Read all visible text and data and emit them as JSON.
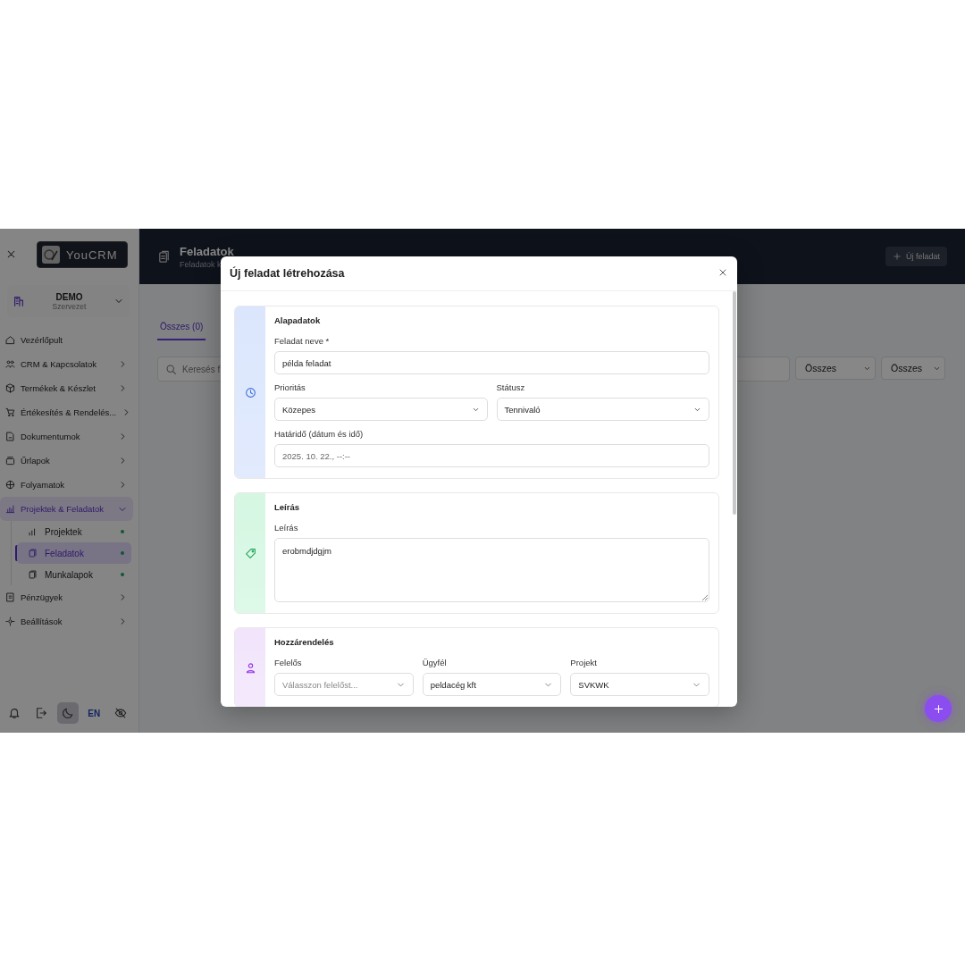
{
  "sidebar": {
    "logo": "YouCRM",
    "org": {
      "name": "DEMO",
      "subtitle": "Szervezet"
    },
    "items": [
      {
        "label": "Vezérlőpult",
        "kind": "link",
        "selected": false
      },
      {
        "label": "CRM & Kapcsolatok",
        "kind": "group",
        "expanded": false,
        "selected": false
      },
      {
        "label": "Termékek & Készlet",
        "kind": "group",
        "expanded": false,
        "selected": false
      },
      {
        "label": "Értékesítés & Rendelés...",
        "kind": "group",
        "expanded": false,
        "selected": false
      },
      {
        "label": "Dokumentumok",
        "kind": "group",
        "expanded": false,
        "selected": false
      },
      {
        "label": "Űrlapok",
        "kind": "group",
        "expanded": false,
        "selected": false
      },
      {
        "label": "Folyamatok",
        "kind": "group",
        "expanded": false,
        "selected": false
      },
      {
        "label": "Projektek & Feladatok",
        "kind": "group",
        "expanded": true,
        "selected": true,
        "children": [
          {
            "label": "Projektek",
            "selected": false
          },
          {
            "label": "Feladatok",
            "selected": true
          },
          {
            "label": "Munkalapok",
            "selected": false
          }
        ]
      },
      {
        "label": "Pénzügyek",
        "kind": "group",
        "expanded": false,
        "selected": false
      },
      {
        "label": "Beállítások",
        "kind": "group",
        "expanded": false,
        "selected": false
      }
    ],
    "footer": [
      {
        "kind": "bell",
        "selected": false
      },
      {
        "kind": "logout",
        "selected": false
      },
      {
        "kind": "moon",
        "selected": true
      },
      {
        "kind": "language",
        "label": "EN",
        "selected": false
      },
      {
        "kind": "eye-off",
        "selected": false
      }
    ]
  },
  "header": {
    "title": "Feladatok",
    "subtitle": "Feladatok k",
    "button": "Új feladat"
  },
  "tabs": [
    {
      "label": "Összes (0)",
      "selected": true
    }
  ],
  "filters": {
    "search": "Keresés f",
    "selects": [
      "Összes",
      "Összes"
    ]
  },
  "modal": {
    "title": "Új feladat létrehozása",
    "sections": [
      {
        "title": "Alapadatok",
        "color": "#dbe6fd",
        "rows": [
          [
            {
              "label": "Feladat neve *",
              "kind": "text",
              "value": "példa feladat"
            }
          ],
          [
            {
              "label": "Prioritás",
              "kind": "select",
              "value": "Közepes"
            },
            {
              "label": "Státusz",
              "kind": "select",
              "value": "Tennivaló"
            }
          ],
          [
            {
              "label": "Határidő (dátum és idő)",
              "kind": "date",
              "value": "2025. 10. 22., --:--"
            }
          ]
        ]
      },
      {
        "title": "Leírás",
        "color": "#d5f7e2",
        "rows": [
          [
            {
              "label": "Leírás",
              "kind": "textarea",
              "value": "erobmdjdgjm"
            }
          ]
        ]
      },
      {
        "title": "Hozzárendelés",
        "color": "#f1e4fb",
        "rows": [
          [
            {
              "label": "Felelős",
              "kind": "combo",
              "placeholder": "Válasszon felelőst..."
            },
            {
              "label": "Ügyfél",
              "kind": "combo",
              "value": "peldacég kft"
            },
            {
              "label": "Projekt",
              "kind": "combo",
              "value": "SVKWK"
            }
          ]
        ]
      }
    ]
  }
}
